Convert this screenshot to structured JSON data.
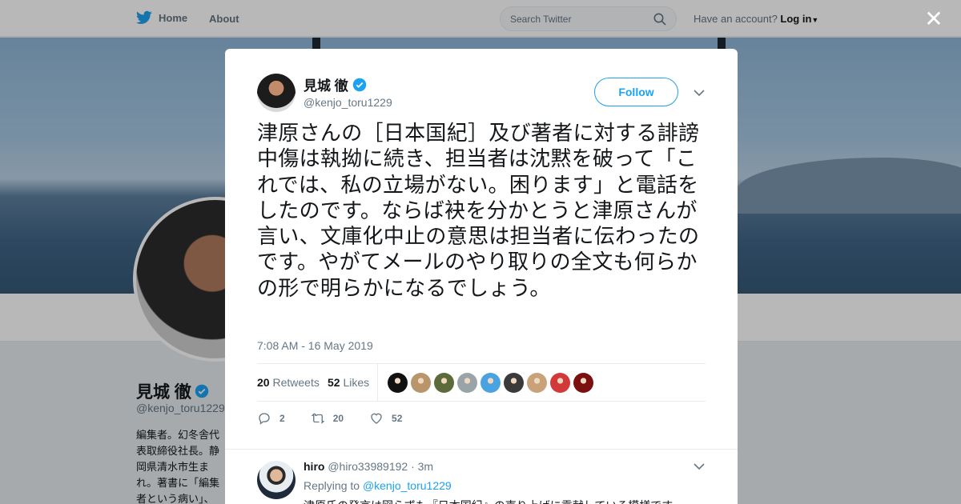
{
  "nav": {
    "home_label": "Home",
    "about_label": "About",
    "search_placeholder": "Search Twitter",
    "account_prompt": "Have an account?",
    "login_label": "Log in"
  },
  "profile": {
    "name": "見城 徹",
    "handle": "@kenjo_toru1229",
    "bio": "編集者。幻冬舎代表取締役社長。静岡県清水市生まれ。著書に「編集者という病い」、「異端者の快楽」、「たった一人の熱狂」、「読書という荒野」、藤田晋との「憂鬱"
  },
  "tweet": {
    "author_name": "見城 徹",
    "author_handle": "@kenjo_toru1229",
    "follow_label": "Follow",
    "text": "津原さんの［日本国紀］及び著者に対する誹謗中傷は執拗に続き、担当者は沈黙を破って「これでは、私の立場がない。困ります」と電話をしたのです。ならば袂を分かとうと津原さんが言い、文庫化中止の意思は担当者に伝わったのです。やがてメールのやり取りの全文も何らかの形で明らかになるでしょう。",
    "timestamp": "7:08 AM - 16 May 2019",
    "retweets_count": "20",
    "retweets_label": "Retweets",
    "likes_count": "52",
    "likes_label": "Likes",
    "likers": [
      {
        "color": "#111111"
      },
      {
        "color": "#b8956a"
      },
      {
        "color": "#5d6b3a"
      },
      {
        "color": "#9aa3a8"
      },
      {
        "color": "#4aa3e0"
      },
      {
        "color": "#3a3a3a"
      },
      {
        "color": "#c9a27a"
      },
      {
        "color": "#d23a3a"
      },
      {
        "color": "#7a1010"
      }
    ],
    "actions": {
      "replies": "2",
      "retweets": "20",
      "likes": "52"
    }
  },
  "reply": {
    "name": "hiro",
    "handle": "@hiro33989192",
    "time": "· 3m",
    "replying_to_label": "Replying to",
    "replying_to_handle": "@kenjo_toru1229",
    "text": "津原氏の発言は図らずも『日本国紀』の売り上げに貢献している模様です。"
  },
  "colors": {
    "accent": "#1da1f2",
    "text_secondary": "#657786"
  },
  "icons": [
    "twitter-bird-icon",
    "search-icon",
    "caret-down-icon",
    "close-icon",
    "verified-icon",
    "chevron-down-icon",
    "reply-icon",
    "retweet-icon",
    "like-icon"
  ]
}
